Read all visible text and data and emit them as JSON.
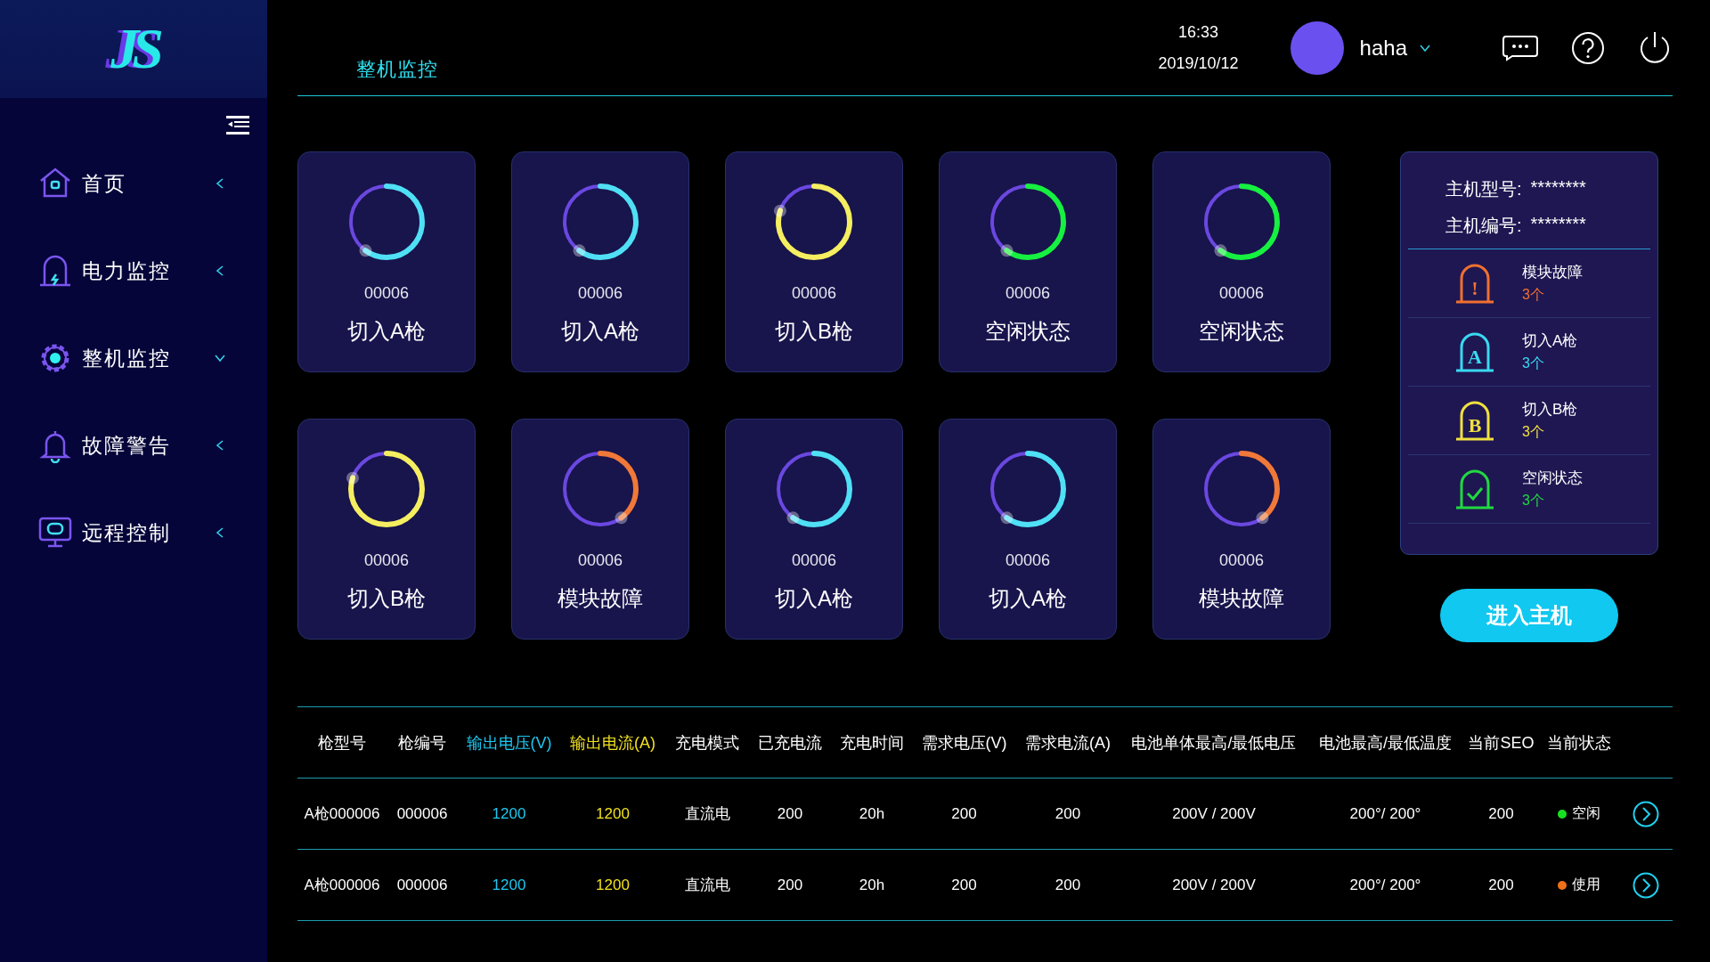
{
  "logo": "JS",
  "sidebar": {
    "items": [
      {
        "label": "首页",
        "expanded": false
      },
      {
        "label": "电力监控",
        "expanded": false
      },
      {
        "label": "整机监控",
        "expanded": true
      },
      {
        "label": "故障警告",
        "expanded": false
      },
      {
        "label": "远程控制",
        "expanded": false
      }
    ]
  },
  "header": {
    "title": "整机监控",
    "time": "16:33",
    "date": "2019/10/12",
    "user": "haha"
  },
  "cards": [
    {
      "code": "00006",
      "status": "切入A枪",
      "kind": "gun_a",
      "level": 0.6
    },
    {
      "code": "00006",
      "status": "切入A枪",
      "kind": "gun_a",
      "level": 0.6
    },
    {
      "code": "00006",
      "status": "切入B枪",
      "kind": "gun_b",
      "level": 0.8
    },
    {
      "code": "00006",
      "status": "空闲状态",
      "kind": "idle",
      "level": 0.6
    },
    {
      "code": "00006",
      "status": "空闲状态",
      "kind": "idle",
      "level": 0.6
    },
    {
      "code": "00006",
      "status": "切入B枪",
      "kind": "gun_b",
      "level": 0.8
    },
    {
      "code": "00006",
      "status": "模块故障",
      "kind": "fault",
      "level": 0.4
    },
    {
      "code": "00006",
      "status": "切入A枪",
      "kind": "gun_a",
      "level": 0.6
    },
    {
      "code": "00006",
      "status": "切入A枪",
      "kind": "gun_a",
      "level": 0.6
    },
    {
      "code": "00006",
      "status": "模块故障",
      "kind": "fault",
      "level": 0.4
    }
  ],
  "host_panel": {
    "model_label": "主机型号:",
    "model": "********",
    "number_label": "主机编号:",
    "number": "********",
    "stats": [
      {
        "kind": "fault",
        "symbol": "!",
        "label": "模块故障",
        "count": "3个"
      },
      {
        "kind": "gun_a",
        "symbol": "A",
        "label": "切入A枪",
        "count": "3个"
      },
      {
        "kind": "gun_b",
        "symbol": "B",
        "label": "切入B枪",
        "count": "3个"
      },
      {
        "kind": "idle",
        "label": "空闲状态",
        "count": "3个"
      }
    ],
    "button": "进入主机"
  },
  "table": {
    "columns": [
      {
        "label": "枪型号",
        "color": "#ffffff"
      },
      {
        "label": "枪编号",
        "color": "#ffffff"
      },
      {
        "label": "输出电压(V)",
        "color": "#1ec8f0"
      },
      {
        "label": "输出电流(A)",
        "color": "#f0e020"
      },
      {
        "label": "充电模式",
        "color": "#ffffff"
      },
      {
        "label": "已充电流",
        "color": "#ffffff"
      },
      {
        "label": "充电时间",
        "color": "#ffffff"
      },
      {
        "label": "需求电压(V)",
        "color": "#ffffff"
      },
      {
        "label": "需求电流(A)",
        "color": "#ffffff"
      },
      {
        "label": "电池单体最高/最低电压",
        "color": "#ffffff"
      },
      {
        "label": "电池最高/最低温度",
        "color": "#ffffff"
      },
      {
        "label": "当前SEO",
        "color": "#ffffff"
      },
      {
        "label": "当前状态",
        "color": "#ffffff"
      }
    ],
    "rows": [
      {
        "cells": [
          "A枪000006",
          "000006",
          "1200",
          "1200",
          "直流电",
          "200",
          "20h",
          "200",
          "200",
          "200V / 200V",
          "200°/ 200°",
          "200"
        ],
        "status": "空闲",
        "color": "#18e020"
      },
      {
        "cells": [
          "A枪000006",
          "000006",
          "1200",
          "1200",
          "直流电",
          "200",
          "20h",
          "200",
          "200",
          "200V / 200V",
          "200°/ 200°",
          "200"
        ],
        "status": "使用",
        "color": "#f07018"
      }
    ]
  }
}
